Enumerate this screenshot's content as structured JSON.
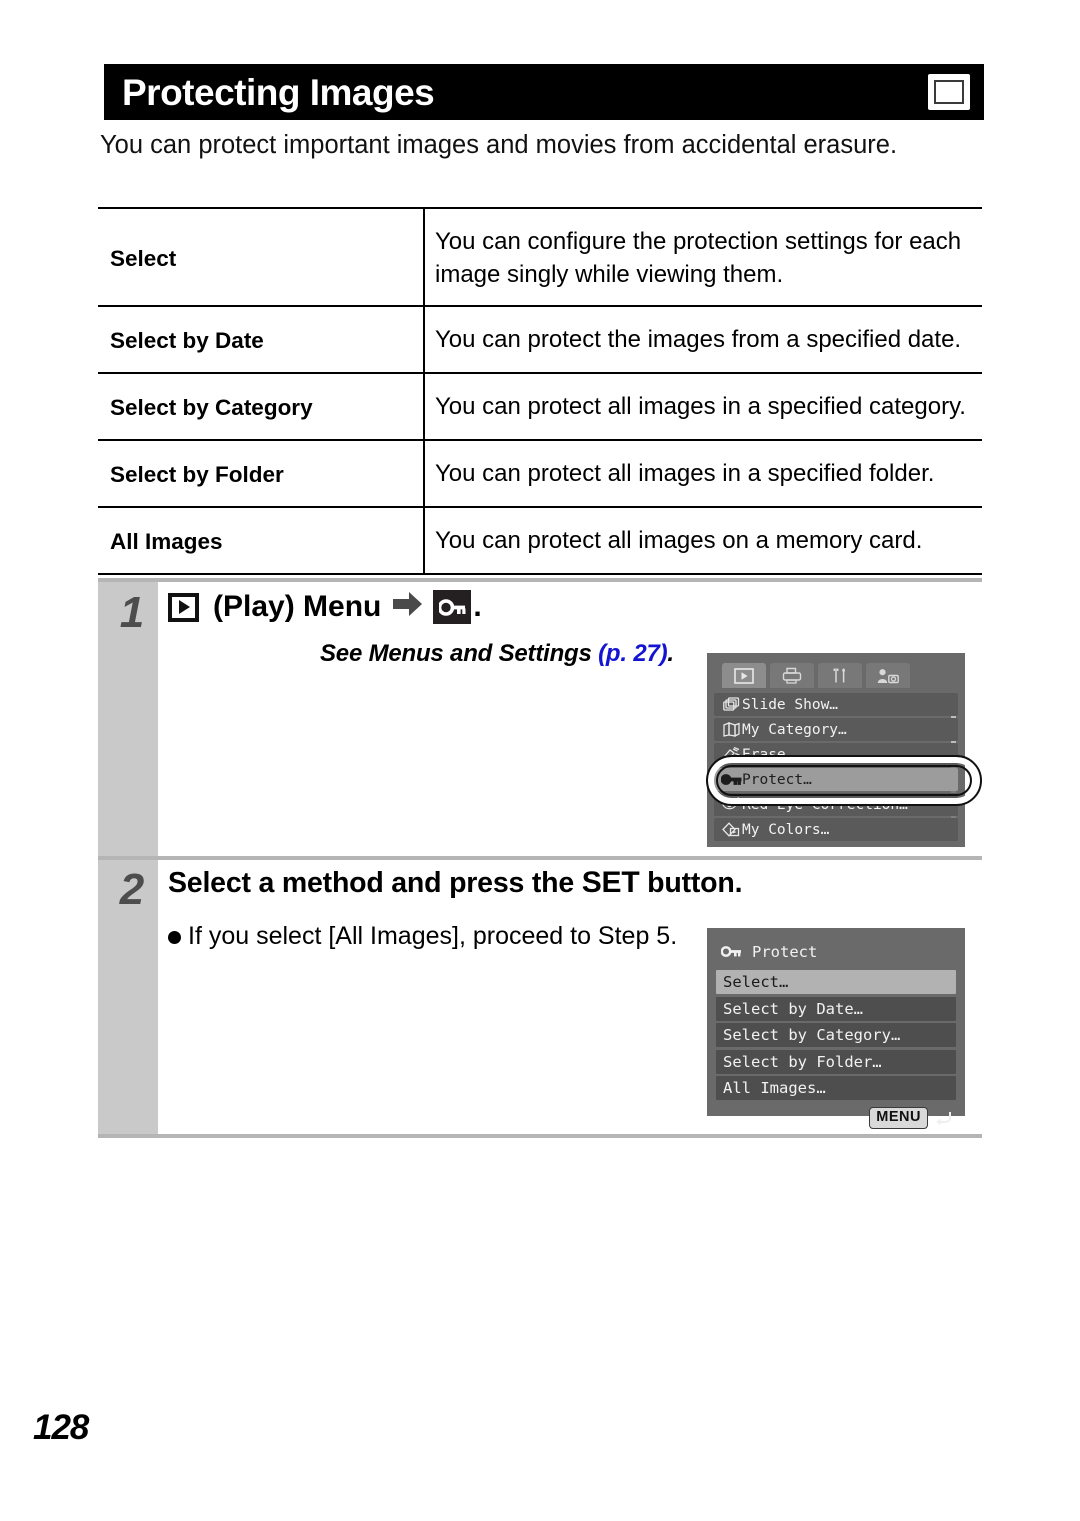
{
  "header": {
    "title": "Protecting Images",
    "badge_icon": "playback-icon"
  },
  "intro": "You can protect important images and movies from accidental erasure.",
  "spec_table": {
    "rows": [
      {
        "term": "Select",
        "desc": "You can configure the protection settings for each image singly while viewing them."
      },
      {
        "term": "Select by Date",
        "desc": "You can protect the images from a specified date."
      },
      {
        "term": "Select by Category",
        "desc": "You can protect all images in a specified category."
      },
      {
        "term": "Select by Folder",
        "desc": "You can protect all images in a specified folder."
      },
      {
        "term": "All Images",
        "desc": "You can protect all images on a memory card."
      }
    ]
  },
  "steps": [
    {
      "number": "1",
      "heading_pre": "",
      "heading_mid": "(Play) Menu",
      "heading_post": ".",
      "see_also_prefix": "See Menus and Settings ",
      "see_also_ref": "(p. 27)",
      "see_also_suffix": "."
    },
    {
      "number": "2",
      "heading_a": "Select a method and press the ",
      "heading_set": "SET",
      "heading_b": " button.",
      "bullet": "If you select [All Images], proceed to Step 5."
    }
  ],
  "lcd_menu_screen": {
    "tabs": [
      {
        "name": "playback-tab",
        "active": true
      },
      {
        "name": "print-tab",
        "active": false
      },
      {
        "name": "settings-tab",
        "active": false
      },
      {
        "name": "my-camera-tab",
        "active": false
      }
    ],
    "items": [
      {
        "label": "Slide Show…",
        "icon": "slideshow-icon",
        "selected": false,
        "clipped": false
      },
      {
        "label": "My Category…",
        "icon": "category-icon",
        "selected": false,
        "clipped": false
      },
      {
        "label": "Erase…",
        "icon": "erase-icon",
        "selected": false,
        "clipped": true
      },
      {
        "label": "Protect…",
        "icon": "key-icon",
        "selected": true,
        "clipped": false
      },
      {
        "label": "Red-Eye Correction…",
        "icon": "redeye-icon",
        "selected": false,
        "clipped": true
      },
      {
        "label": "My Colors…",
        "icon": "mycolors-icon",
        "selected": false,
        "clipped": false
      }
    ],
    "callout": "Protect…"
  },
  "lcd_protect_screen": {
    "title": "Protect",
    "title_icon": "key-icon",
    "options": [
      {
        "label": "Select…",
        "selected": true
      },
      {
        "label": "Select by Date…",
        "selected": false
      },
      {
        "label": "Select by Category…",
        "selected": false
      },
      {
        "label": "Select by Folder…",
        "selected": false
      },
      {
        "label": "All Images…",
        "selected": false
      }
    ],
    "footer_button": "MENU",
    "footer_icon": "return-arrow-icon"
  },
  "page_number": "128",
  "colors": {
    "title_bar": "#000000",
    "step_gray": "#c9c9c9",
    "link_blue": "#1414d2",
    "lcd_bg": "#6a6a6a"
  }
}
